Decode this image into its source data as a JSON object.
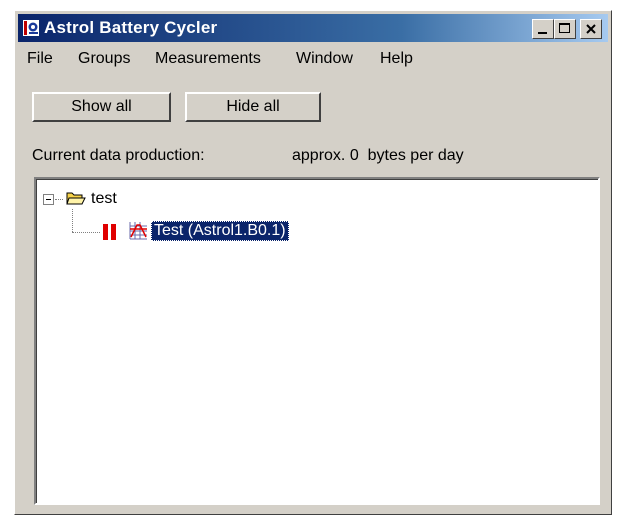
{
  "window": {
    "title": "Astrol Battery Cycler"
  },
  "menu": {
    "items": [
      "File",
      "Groups",
      "Measurements",
      "Window",
      "Help"
    ]
  },
  "toolbar": {
    "show_all_label": "Show all",
    "hide_all_label": "Hide all"
  },
  "status": {
    "production_label": "Current data production:",
    "production_value": "approx. 0  bytes per day"
  },
  "tree": {
    "group": {
      "label": "test",
      "expanded": true,
      "icon": "open-folder-icon"
    },
    "items": [
      {
        "label": "Test (Astrol1.B0.1)",
        "selected": true,
        "state_icon": "pause-icon",
        "type_icon": "chart-icon"
      }
    ]
  },
  "colors": {
    "titlebar_start": "#0a246a",
    "titlebar_end": "#a6caf0",
    "window_bg": "#d4d0c8",
    "selection_bg": "#0a246a",
    "pause_red": "#e00000"
  }
}
